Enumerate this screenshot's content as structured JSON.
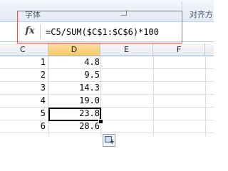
{
  "ribbon": {
    "font_group_label": "字体",
    "alignment_group_label": "对齐方"
  },
  "formula_bar": {
    "fx_label": "fx",
    "formula": "=C5/SUM($C$1:$C$6)*100"
  },
  "columns": [
    "C",
    "D",
    "E",
    "F"
  ],
  "selected_column": "D",
  "rows": [
    {
      "c": "1",
      "d": "4.8"
    },
    {
      "c": "2",
      "d": "9.5"
    },
    {
      "c": "3",
      "d": "14.3"
    },
    {
      "c": "4",
      "d": "19.0"
    },
    {
      "c": "5",
      "d": "23.8"
    },
    {
      "c": "6",
      "d": "28.6"
    }
  ],
  "active_cell": "D5",
  "icons": {
    "launcher": "dialog-launcher-icon",
    "autofill": "autofill-options-icon"
  },
  "colors": {
    "highlight_box": "#e0574f",
    "selected_header": "#f6c865"
  }
}
